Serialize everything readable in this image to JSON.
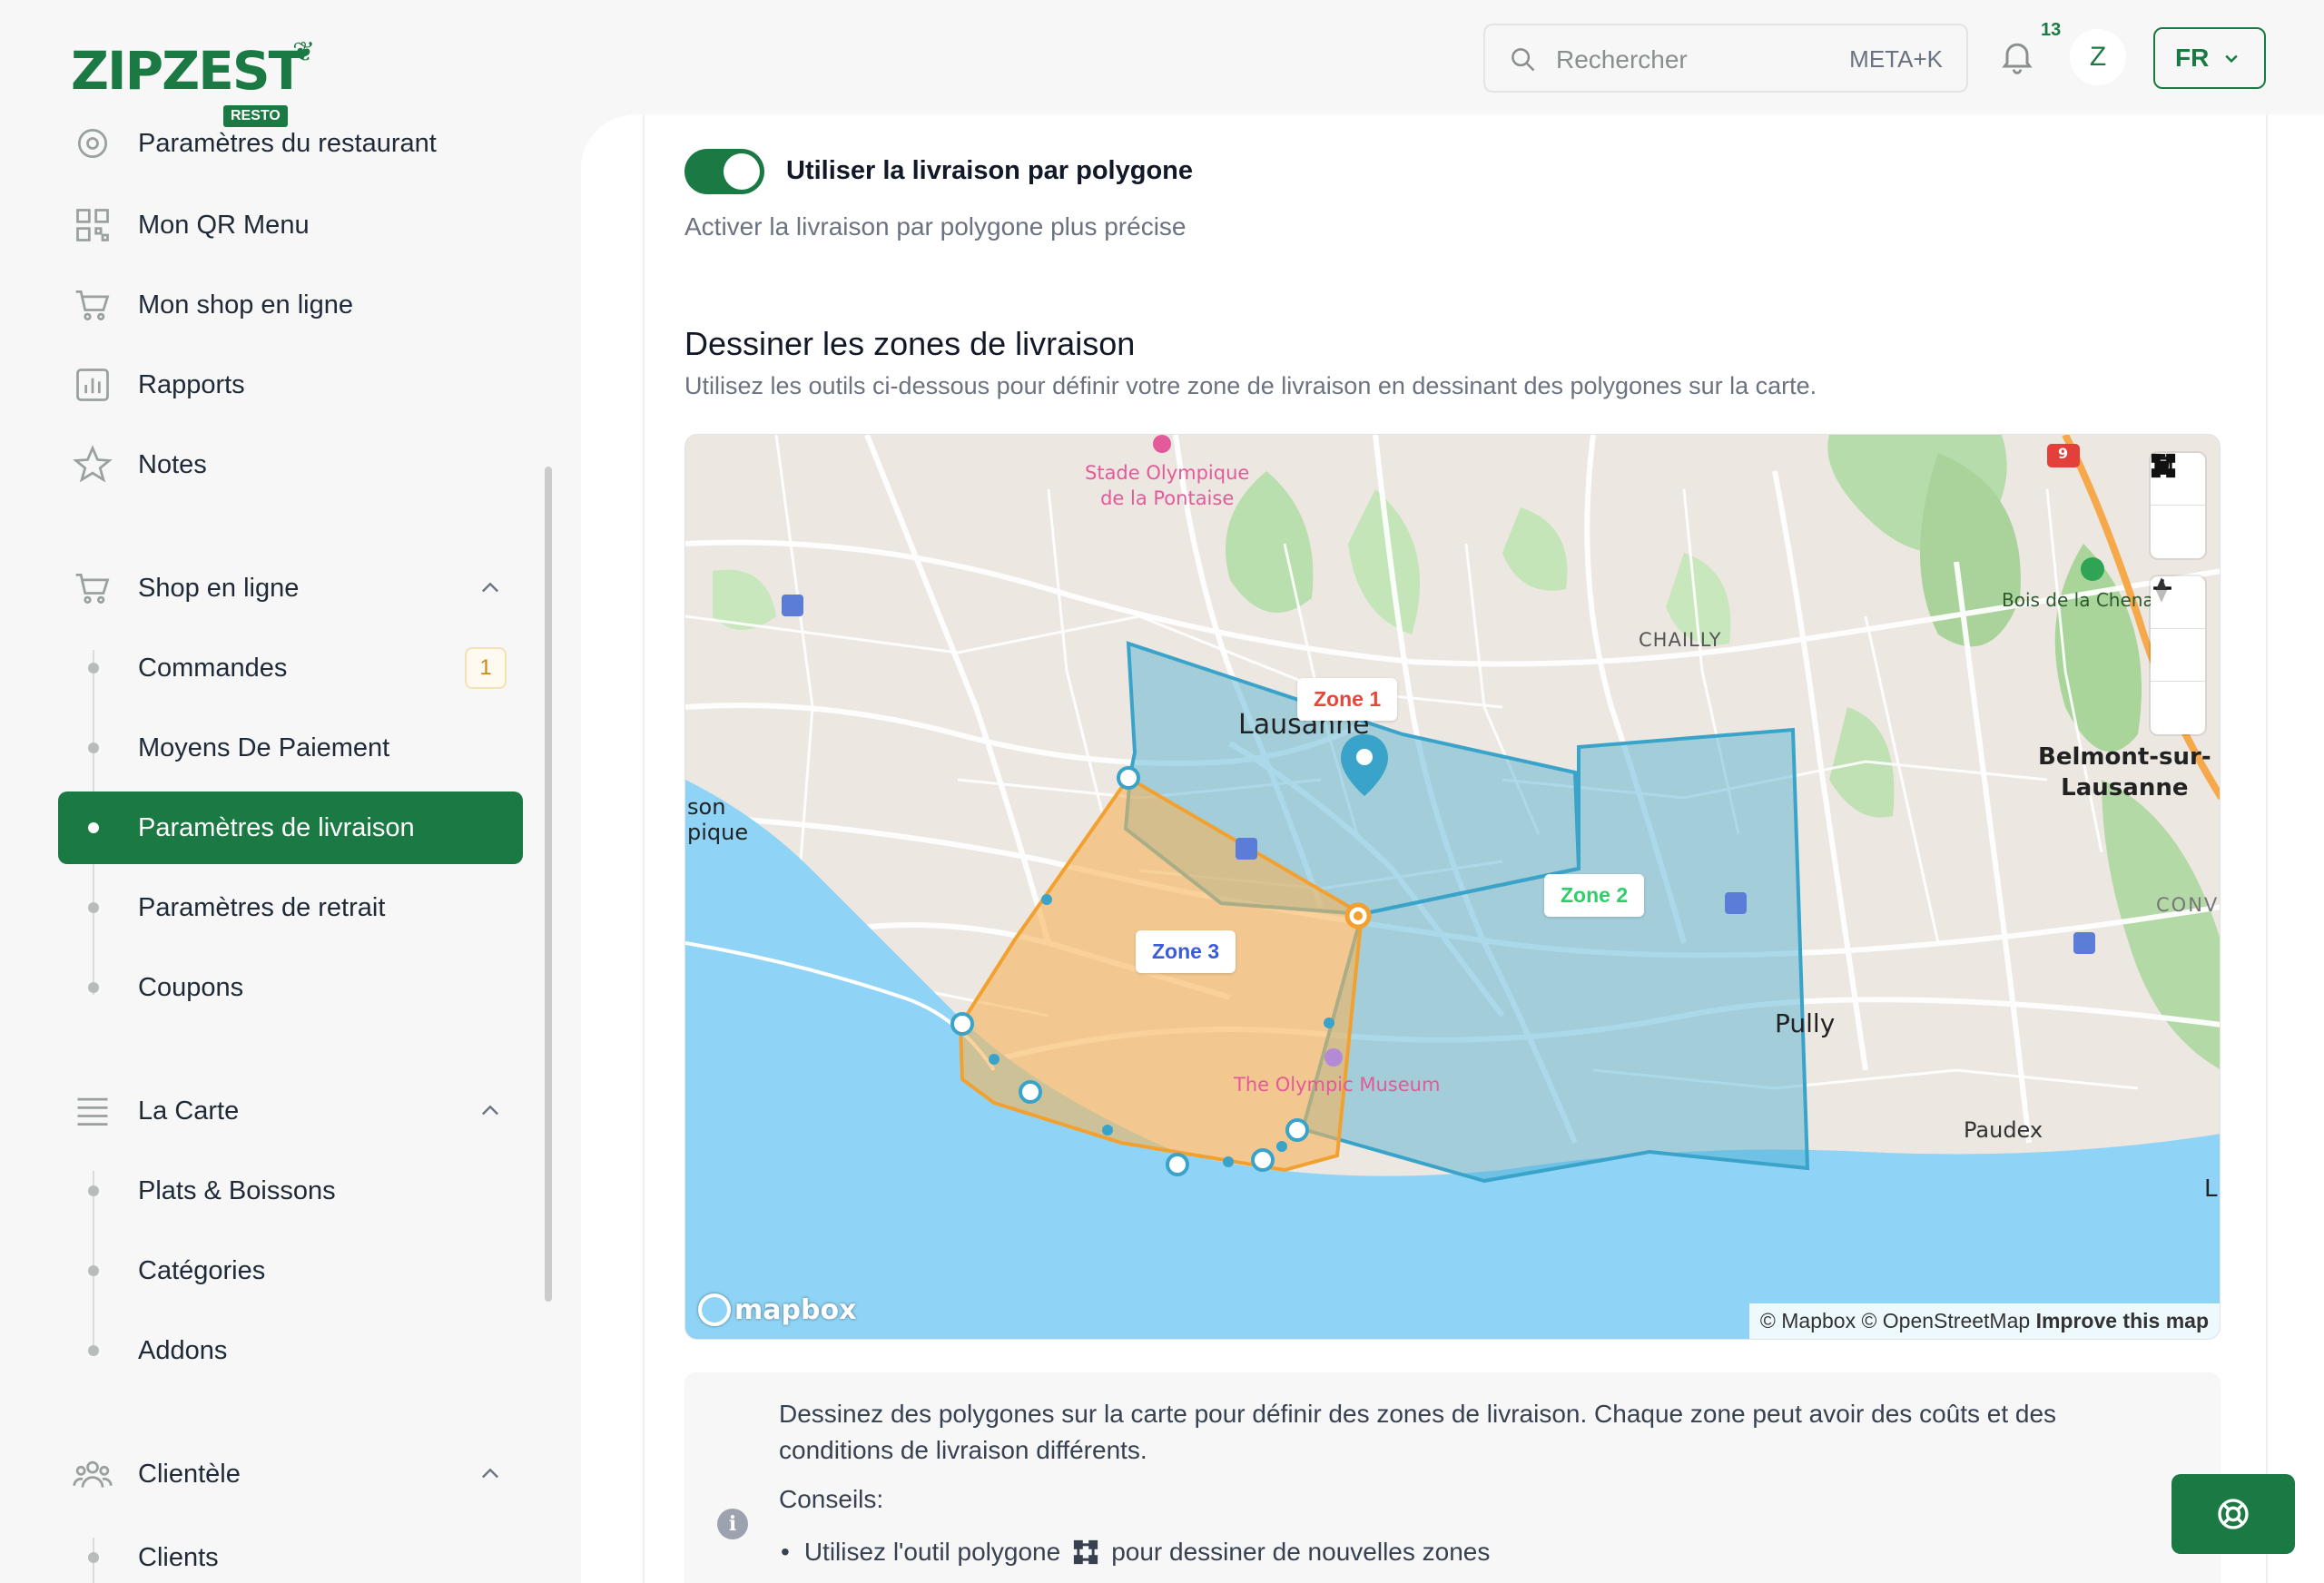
{
  "brand": {
    "name": "ZIPZEST",
    "badge": "RESTO"
  },
  "header": {
    "search_placeholder": "Rechercher",
    "search_shortcut": "META+K",
    "notification_count": "13",
    "avatar_initial": "Z",
    "language": "FR"
  },
  "sidebar": {
    "top_items": [
      {
        "label": "Paramètres du restaurant",
        "icon": "settings-icon"
      },
      {
        "label": "Mon QR Menu",
        "icon": "qr-code-icon"
      },
      {
        "label": "Mon shop en ligne",
        "icon": "cart-icon"
      },
      {
        "label": "Rapports",
        "icon": "chart-icon"
      },
      {
        "label": "Notes",
        "icon": "star-icon"
      }
    ],
    "shop_section": {
      "label": "Shop en ligne",
      "items": [
        {
          "label": "Commandes",
          "badge": "1"
        },
        {
          "label": "Moyens De Paiement"
        },
        {
          "label": "Paramètres de livraison",
          "active": true
        },
        {
          "label": "Paramètres de retrait"
        },
        {
          "label": "Coupons"
        }
      ]
    },
    "carte_section": {
      "label": "La Carte",
      "items": [
        {
          "label": "Plats & Boissons"
        },
        {
          "label": "Catégories"
        },
        {
          "label": "Addons"
        }
      ]
    },
    "client_section": {
      "label": "Clientèle",
      "items": [
        {
          "label": "Clients"
        }
      ]
    }
  },
  "main": {
    "toggle_label": "Utiliser la livraison par polygone",
    "toggle_on": true,
    "toggle_description": "Activer la livraison par polygone plus précise",
    "section_title": "Dessiner les zones de livraison",
    "section_description": "Utilisez les outils ci-dessous pour définir votre zone de livraison en dessinant des polygones sur la carte.",
    "map": {
      "zones": [
        {
          "label": "Zone 1",
          "color": "#e5483b"
        },
        {
          "label": "Zone 2",
          "color": "#2fce6a"
        },
        {
          "label": "Zone 3",
          "color": "#3b5bdb"
        }
      ],
      "place_labels": {
        "stade": "Stade Olympique",
        "stade2": "de la Pontaise",
        "lausanne": "Lausanne",
        "chailly": "CHAILLY",
        "bois": "Bois de la Chenaie",
        "belmont1": "Belmont-sur-",
        "belmont2": "Lausanne",
        "pully": "Pully",
        "paudex": "Paudex",
        "museum": "The Olympic Museum",
        "conv": "CONV",
        "son": "son",
        "pique": "pique",
        "l": "L",
        "route": "9"
      },
      "logo": "mapbox",
      "attribution": "© Mapbox © OpenStreetMap",
      "improve_link": "Improve this map"
    },
    "info": {
      "text": "Dessinez des polygones sur la carte pour définir des zones de livraison. Chaque zone peut avoir des coûts et des conditions de livraison différents.",
      "tips_label": "Conseils:",
      "tip1_before": "Utilisez l'outil polygone",
      "tip1_after": "pour dessiner de nouvelles zones"
    }
  },
  "colors": {
    "brand": "#1b7a43",
    "zone_blue": "#4aaed1",
    "zone_orange": "#f5a23b",
    "water": "#8fd3f5"
  }
}
